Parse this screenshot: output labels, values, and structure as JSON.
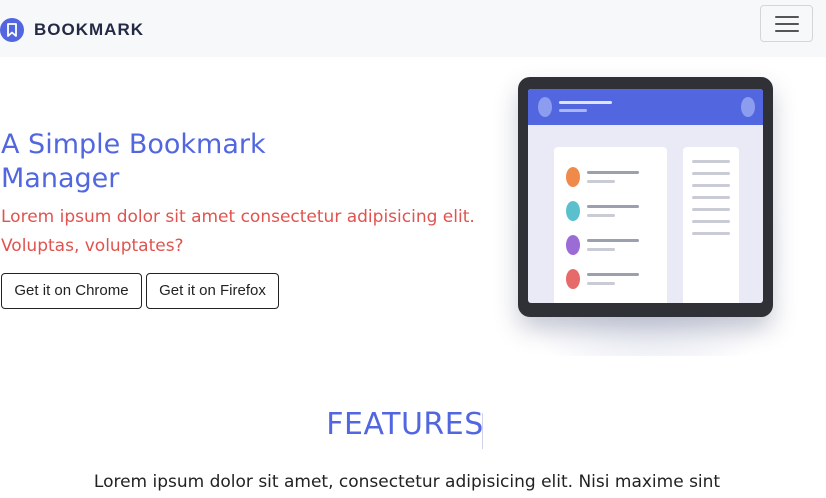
{
  "navbar": {
    "brand": "BOOKMARK",
    "logo_icon": "bookmark-icon",
    "menu_icon": "hamburger-menu-icon",
    "brand_color": "#5267df"
  },
  "hero": {
    "title": "A Simple Bookmark Manager",
    "subtitle": "Lorem ipsum dolor sit amet consectetur adipisicing elit. Voluptas, voluptates?",
    "buttons": {
      "chrome": "Get it on Chrome",
      "firefox": "Get it on Firefox"
    }
  },
  "illustration": {
    "bookmark_dot_colors": [
      "#f08a4b",
      "#5bc0ce",
      "#9b6cd6",
      "#e66a6a"
    ]
  },
  "features": {
    "title": "FEATURES",
    "text": "Lorem ipsum dolor sit amet, consectetur adipisicing elit. Nisi maxime sint"
  },
  "colors": {
    "accent": "#5267df",
    "subtitle": "#e0534f"
  }
}
